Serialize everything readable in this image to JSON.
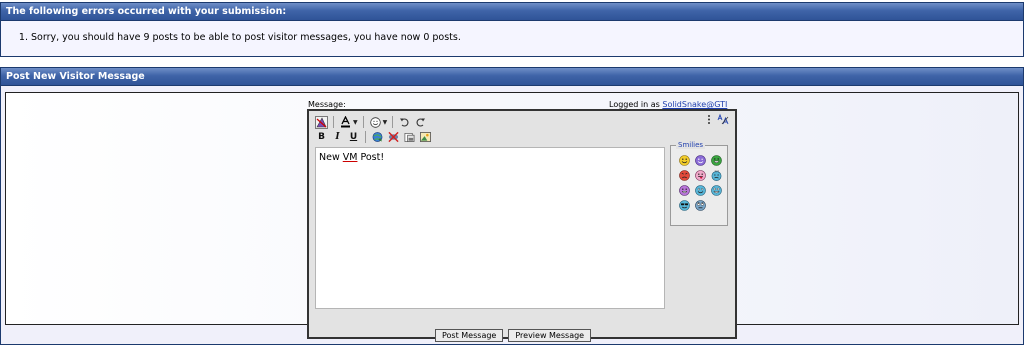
{
  "errors": {
    "title": "The following errors occurred with your submission:",
    "items": [
      "Sorry, you should have 9 posts to be able to post visitor messages, you have now 0 posts."
    ]
  },
  "visitor_message": {
    "title": "Post New Visitor Message",
    "message_label": "Message:",
    "logged_in_prefix": "Logged in as",
    "username": "SolidSnake@GTI",
    "text_before": "New ",
    "text_underlined": "VM",
    "text_after": " Post!",
    "smilies_label": "Smilies",
    "smilies": [
      "smile-icon",
      "wink-icon",
      "grin-icon",
      "mad-icon",
      "tongue-icon",
      "confused-icon",
      "evil-icon",
      "cool-face-icon",
      "eek-icon",
      "shades-icon",
      "rolleyes-icon"
    ]
  },
  "toolbar": {
    "bold_label": "B",
    "italic_label": "I",
    "underline_label": "U"
  },
  "buttons": {
    "post_label": "Post Message",
    "preview_label": "Preview Message"
  },
  "colors": {
    "header_blue": "#3f64a8",
    "link_blue": "#1f3fae",
    "smiley_yellow": "#f2cc2a",
    "smiley_purple": "#8a6bd6",
    "smiley_green": "#3aa540",
    "smiley_red": "#e24a3b",
    "smiley_blue": "#58b6d8"
  }
}
